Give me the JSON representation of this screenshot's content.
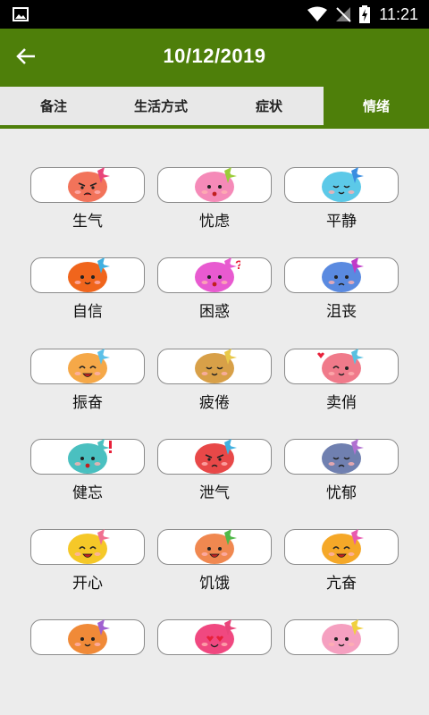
{
  "status_bar": {
    "time": "11:21"
  },
  "app_bar": {
    "title": "10/12/2019"
  },
  "tabs": [
    {
      "label": "备注",
      "active": false
    },
    {
      "label": "生活方式",
      "active": false
    },
    {
      "label": "症状",
      "active": false
    },
    {
      "label": "情绪",
      "active": true
    }
  ],
  "moods": [
    {
      "label": "生气",
      "face_color": "#f2735a",
      "bow_color": "#e8457a",
      "expression": "angry"
    },
    {
      "label": "忧虑",
      "face_color": "#f58ab8",
      "bow_color": "#9ccc3a",
      "expression": "worried"
    },
    {
      "label": "平静",
      "face_color": "#5cc9e8",
      "bow_color": "#3a8de0",
      "expression": "calm"
    },
    {
      "label": "自信",
      "face_color": "#f0651c",
      "bow_color": "#40b0e0",
      "expression": "confident"
    },
    {
      "label": "困惑",
      "face_color": "#e85ad0",
      "bow_color": "#e85ad0",
      "expression": "confused",
      "mark": "?"
    },
    {
      "label": "沮丧",
      "face_color": "#5a8ae0",
      "bow_color": "#c03ac8",
      "expression": "sad"
    },
    {
      "label": "振奋",
      "face_color": "#f5a848",
      "bow_color": "#5cc0e8",
      "expression": "excited"
    },
    {
      "label": "疲倦",
      "face_color": "#d8a048",
      "bow_color": "#e8c848",
      "expression": "tired"
    },
    {
      "label": "卖俏",
      "face_color": "#f07a8a",
      "bow_color": "#5ac0e0",
      "expression": "flirty",
      "mark": "heart"
    },
    {
      "label": "健忘",
      "face_color": "#4ac0c0",
      "bow_color": "#4ac0c0",
      "expression": "forgetful",
      "mark": "!"
    },
    {
      "label": "泄气",
      "face_color": "#e84848",
      "bow_color": "#40b0e0",
      "expression": "discouraged"
    },
    {
      "label": "忧郁",
      "face_color": "#7080b0",
      "bow_color": "#b070d0",
      "expression": "gloomy"
    },
    {
      "label": "开心",
      "face_color": "#f5c828",
      "bow_color": "#f07090",
      "expression": "happy"
    },
    {
      "label": "饥饿",
      "face_color": "#f08850",
      "bow_color": "#50b848",
      "expression": "hungry"
    },
    {
      "label": "亢奋",
      "face_color": "#f5a828",
      "bow_color": "#e85ab0",
      "expression": "hyper"
    },
    {
      "label": "",
      "face_color": "#f08a38",
      "bow_color": "#a060d0",
      "expression": "neutral"
    },
    {
      "label": "",
      "face_color": "#f04880",
      "bow_color": "#e8457a",
      "expression": "love"
    },
    {
      "label": "",
      "face_color": "#f5a0c0",
      "bow_color": "#f0d040",
      "expression": "shy"
    }
  ]
}
